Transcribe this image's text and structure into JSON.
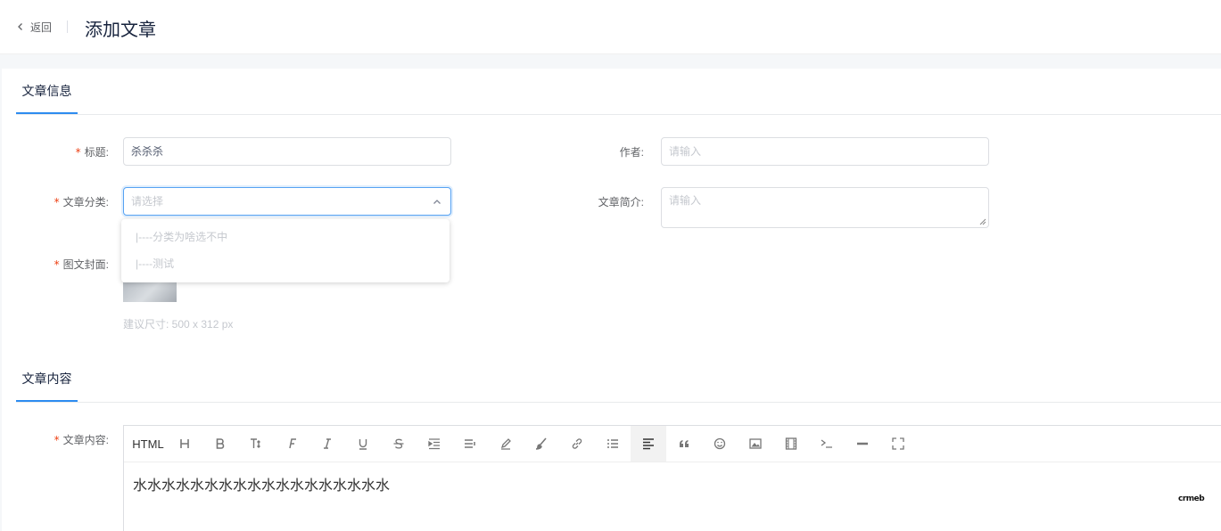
{
  "header": {
    "back_label": "返回",
    "title": "添加文章"
  },
  "sections": {
    "info_tab": "文章信息",
    "content_tab": "文章内容"
  },
  "form": {
    "title_label": "标题:",
    "title_value": "杀杀杀",
    "author_label": "作者:",
    "author_placeholder": "请输入",
    "category_label": "文章分类:",
    "category_placeholder": "请选择",
    "category_options": [
      "|----分类为啥选不中",
      "|----测试"
    ],
    "summary_label": "文章简介:",
    "summary_placeholder": "请输入",
    "cover_label": "图文封面:",
    "cover_hint": "建议尺寸: 500 x 312 px",
    "content_label": "文章内容:"
  },
  "editor": {
    "html_label": "HTML",
    "tools": [
      "heading-icon",
      "bold-icon",
      "font-size-icon",
      "font-family-icon",
      "italic-icon",
      "underline-icon",
      "strikethrough-icon",
      "indent-icon",
      "line-height-icon",
      "font-color-icon",
      "background-color-icon",
      "link-icon",
      "list-icon",
      "align-icon",
      "quote-icon",
      "emoticon-icon",
      "image-icon",
      "video-icon",
      "code-icon",
      "divider-icon",
      "fullscreen-icon"
    ],
    "content": "水水水水水水水水水水水水水水水水水水"
  },
  "watermark": "crmeb",
  "colors": {
    "accent": "#2d8cf0",
    "required": "#ed4014",
    "placeholder": "#c5c8ce"
  }
}
